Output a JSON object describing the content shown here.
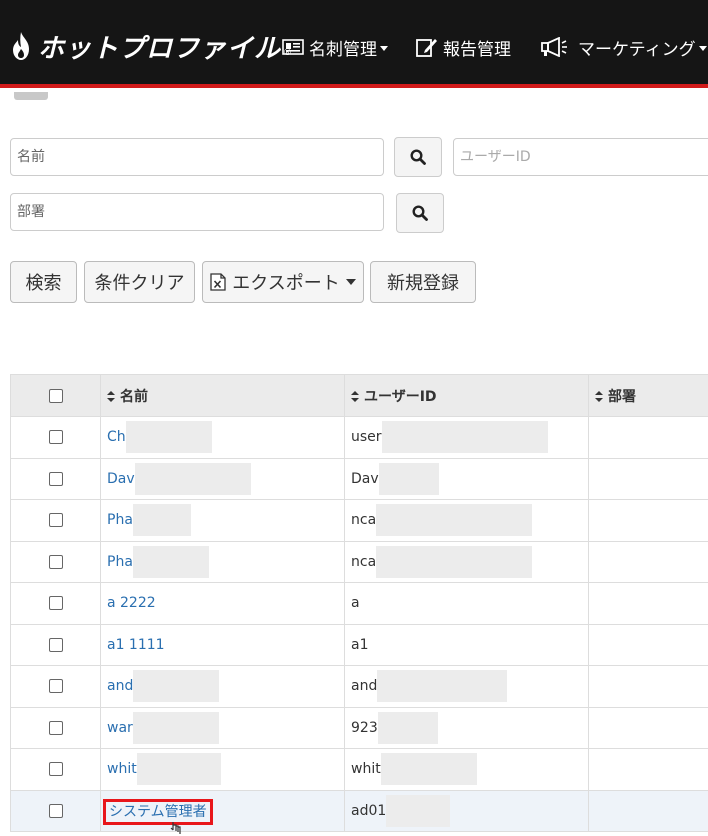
{
  "header": {
    "brand": "ホットプロファイル",
    "brand_reg": "®",
    "nav": [
      {
        "label": "名刺管理",
        "icon": "card-icon",
        "dropdown": true
      },
      {
        "label": "報告管理",
        "icon": "edit-report-icon",
        "dropdown": false
      },
      {
        "label": "マーケティング",
        "icon": "megaphone-icon",
        "dropdown": true
      }
    ]
  },
  "search": {
    "name_placeholder": "名前",
    "dept_placeholder": "部署",
    "userid_placeholder": "ユーザーID"
  },
  "actions": {
    "search": "検索",
    "clear": "条件クリア",
    "export": "エクスポート",
    "new": "新規登録"
  },
  "table": {
    "columns": [
      "名前",
      "ユーザーID",
      "部署"
    ],
    "rows": [
      {
        "name": "Ch",
        "userid": "user"
      },
      {
        "name": "Dav",
        "userid": "Dav"
      },
      {
        "name": "Pha",
        "userid": "nca"
      },
      {
        "name": "Pha",
        "userid": "nca"
      },
      {
        "name": "a 2222",
        "userid": "a"
      },
      {
        "name": "a1 1111",
        "userid": "a1"
      },
      {
        "name": "and",
        "userid": "and"
      },
      {
        "name": "war",
        "userid": "923"
      },
      {
        "name": "whit",
        "userid": "whit"
      },
      {
        "name": "システム管理者",
        "userid": "ad01"
      }
    ]
  },
  "colors": {
    "header_bg": "#151515",
    "accent_red": "#d11a1a",
    "link": "#2a6fb0",
    "highlight": "#e8161b"
  }
}
